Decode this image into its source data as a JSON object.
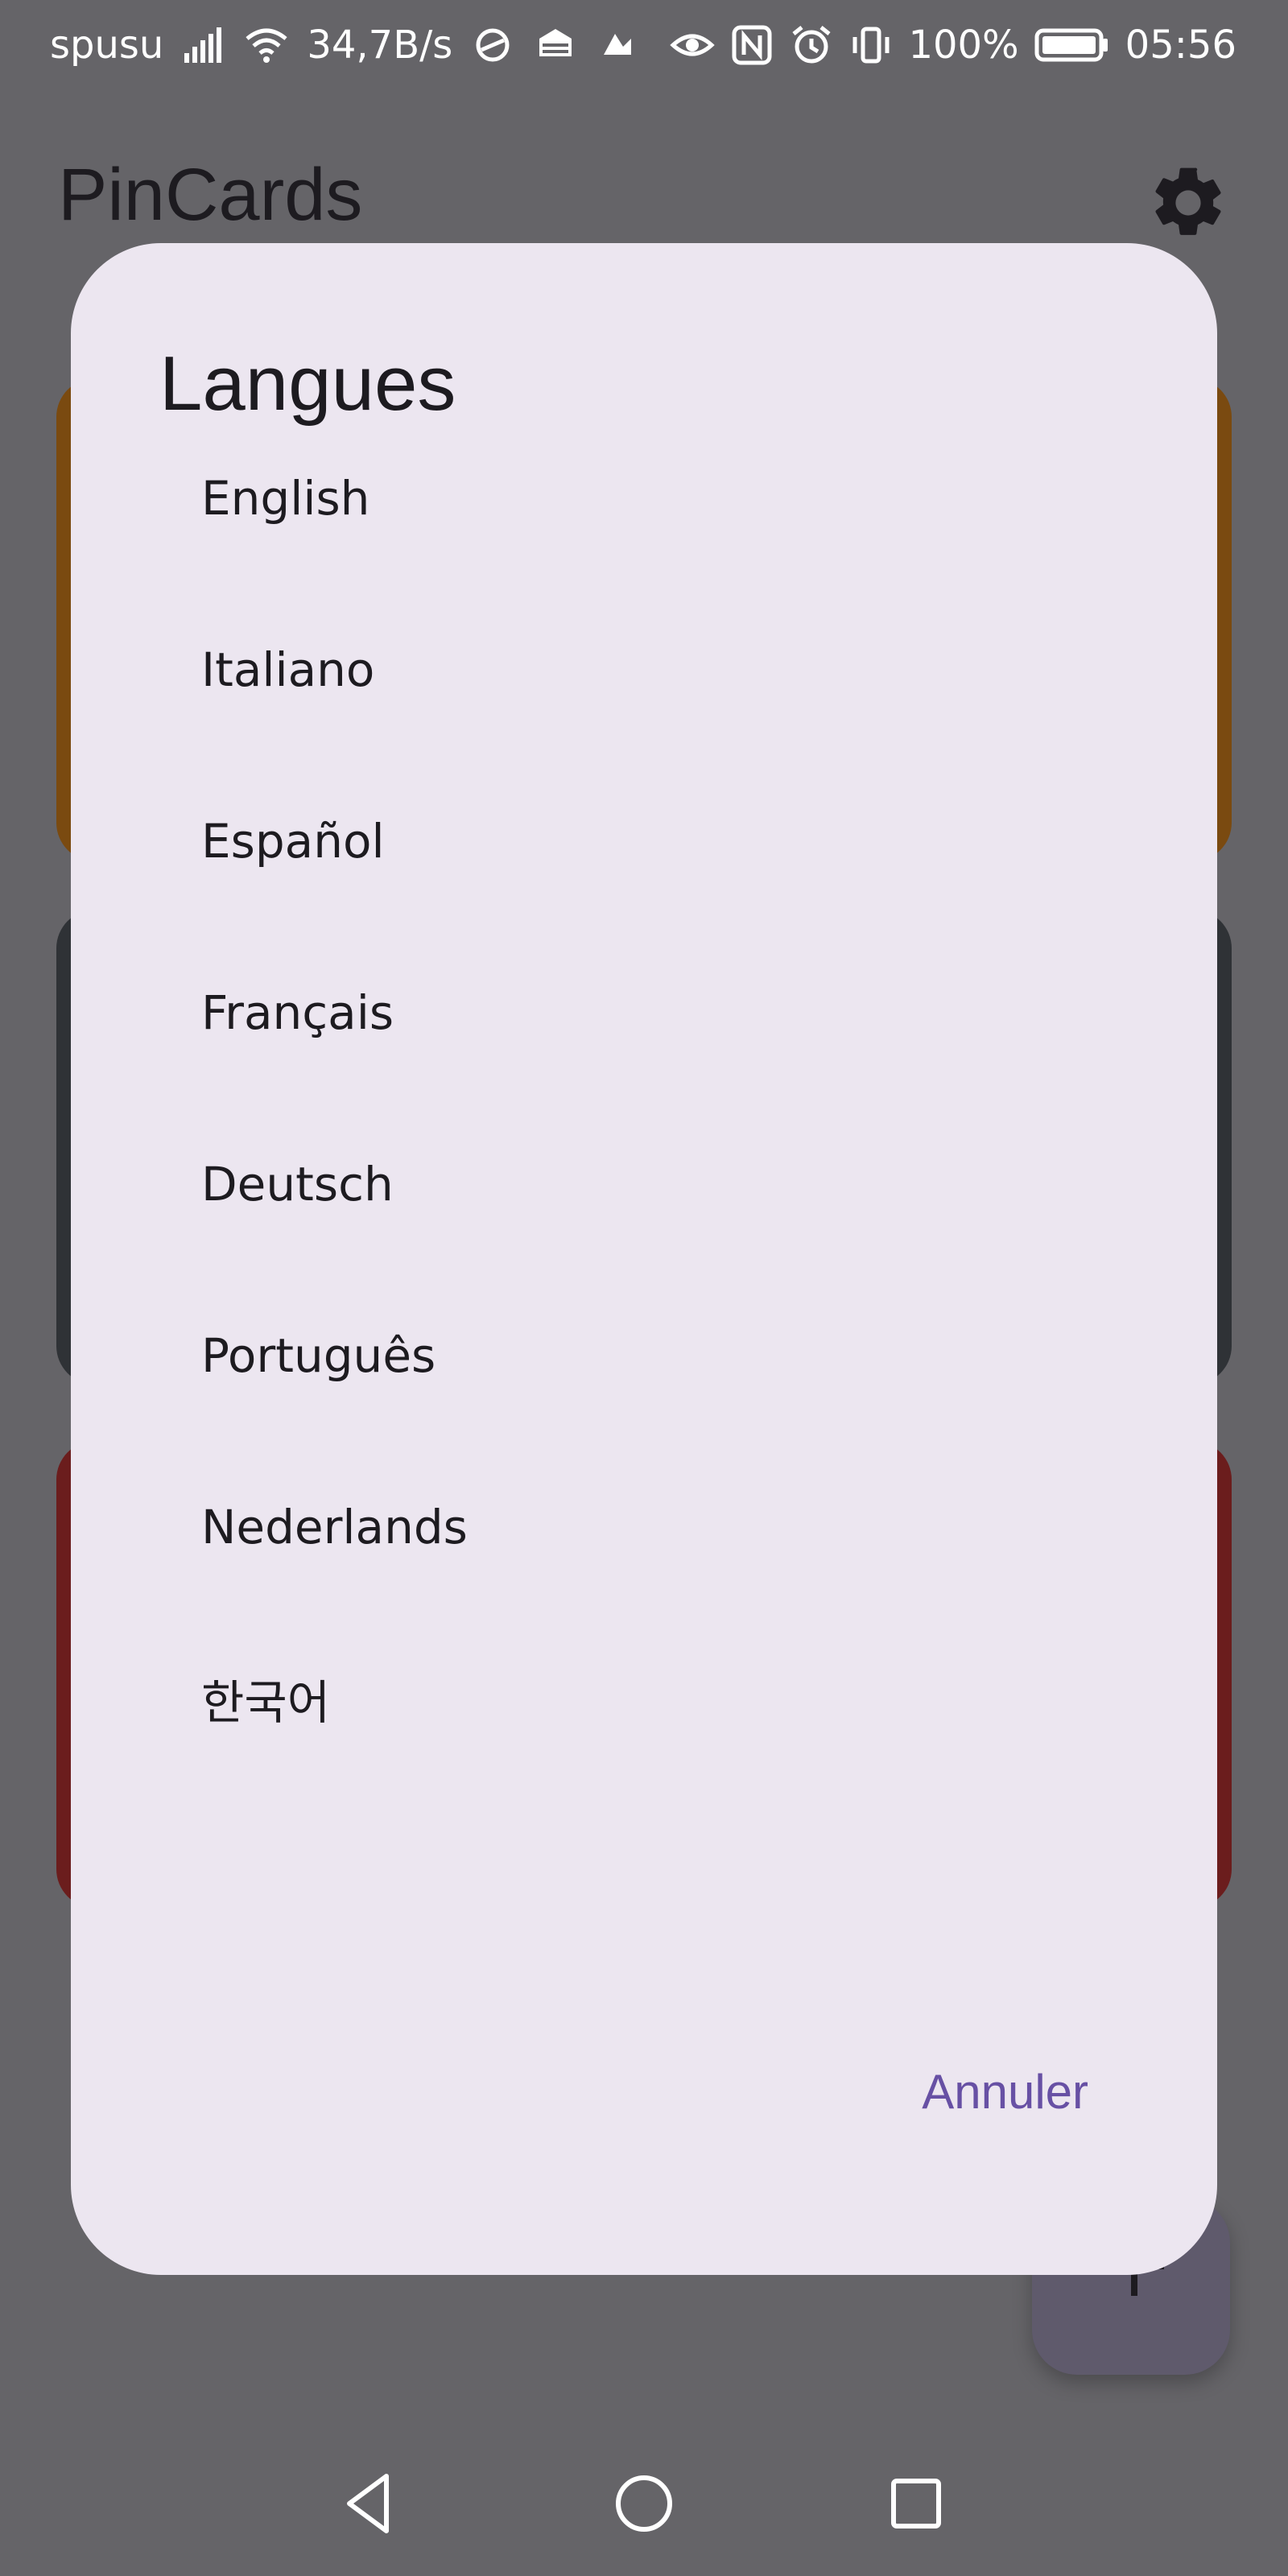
{
  "status_bar": {
    "carrier": "spusu",
    "net_speed": "34,7B/s",
    "battery_percent": "100%",
    "time": "05:56",
    "icons": [
      "signal-icon",
      "wifi-icon",
      "app-notification-icon",
      "app-notification-icon",
      "app-notification-icon",
      "eye-icon",
      "nfc-icon",
      "alarm-icon",
      "vibrate-icon",
      "battery-icon"
    ]
  },
  "app": {
    "title": "PinCards",
    "settings_icon": "gear-icon",
    "fab_icon": "plus-icon",
    "card_colors": [
      "#7a4a10",
      "#2f3236",
      "#6b1d1d"
    ]
  },
  "dialog": {
    "title": "Langues",
    "languages": [
      "English",
      "Italiano",
      "Español",
      "Français",
      "Deutsch",
      "Português",
      "Nederlands",
      "한국어"
    ],
    "cancel_label": "Annuler",
    "accent_color": "#6750a4"
  },
  "nav_bar": {
    "icons": [
      "back-icon",
      "home-icon",
      "recent-apps-icon"
    ]
  }
}
